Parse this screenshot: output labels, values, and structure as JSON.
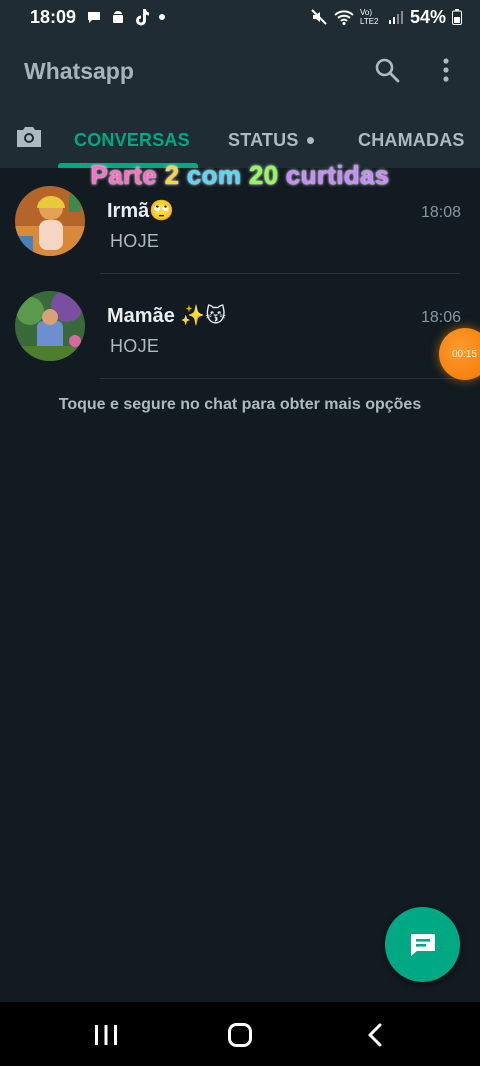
{
  "status_bar": {
    "time": "18:09",
    "network_label": "Vo) LTE2",
    "battery": "54%"
  },
  "app_bar": {
    "title": "Whatsapp",
    "icons": [
      "search-icon",
      "more-vert-icon"
    ]
  },
  "tabs": [
    {
      "label": "CONVERSAS",
      "active": true
    },
    {
      "label": "STATUS",
      "active": false
    },
    {
      "label": "CHAMADAS",
      "active": false
    }
  ],
  "overlay": {
    "words": [
      {
        "text": "Parte",
        "color": "#ff6ec7"
      },
      {
        "text": "2",
        "color": "#ffd23f"
      },
      {
        "text": "com",
        "color": "#7ee8fa"
      },
      {
        "text": "20",
        "color": "#a6ff4d"
      },
      {
        "text": "curtidas",
        "color": "#c58bff"
      }
    ]
  },
  "chats": [
    {
      "name": "Irmã🙄",
      "time": "18:08",
      "preview": "HOJE"
    },
    {
      "name": "Mamãe ✨😽",
      "time": "18:06",
      "preview": "HOJE"
    }
  ],
  "hint": "Toque e segure no chat para obter mais opções",
  "recording": {
    "timer": "00:15"
  },
  "colors": {
    "accent": "#00a884",
    "background": "#111b21",
    "header": "#1f2c33",
    "recording": "#f07800"
  }
}
